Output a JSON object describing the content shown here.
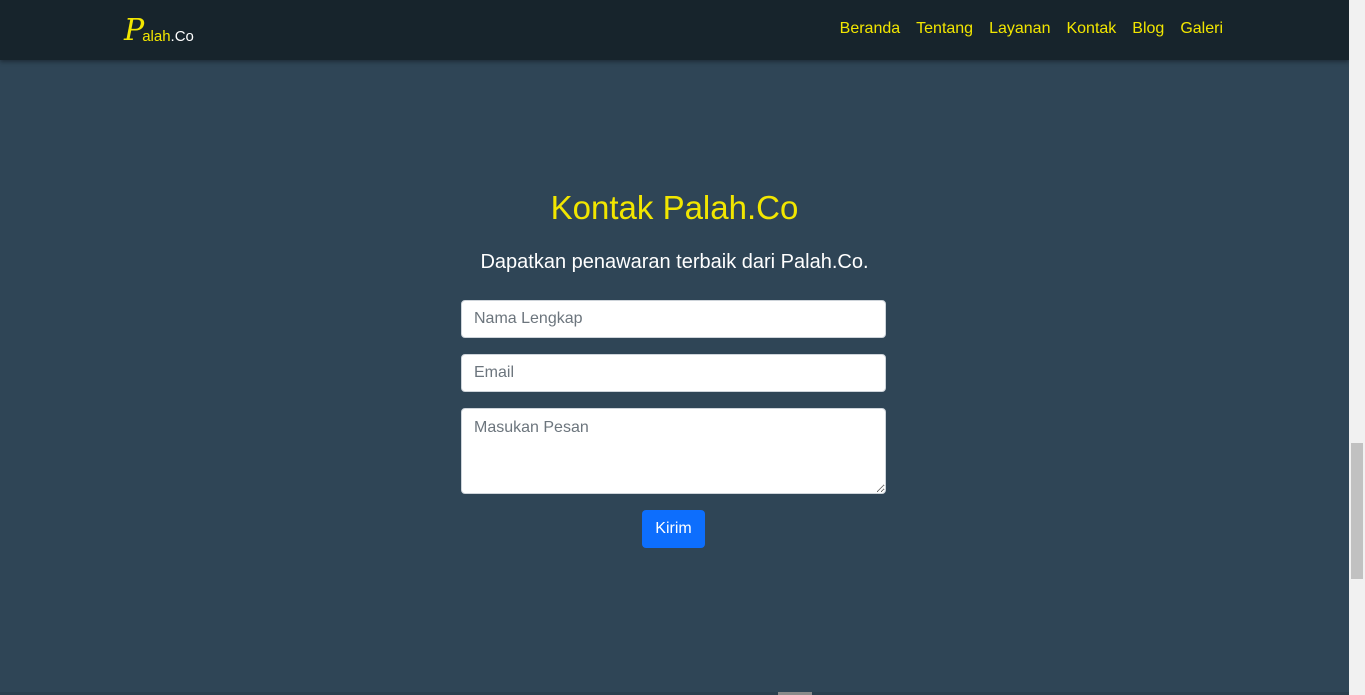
{
  "navbar": {
    "logo": {
      "initial": "P",
      "rest_a": "alah",
      "rest_b": ".Co"
    },
    "links": [
      "Beranda",
      "Tentang",
      "Layanan",
      "Kontak",
      "Blog",
      "Galeri"
    ]
  },
  "contact": {
    "title": "Kontak Palah.Co",
    "subtitle": "Dapatkan penawaran terbaik dari Palah.Co.",
    "name_placeholder": "Nama Lengkap",
    "email_placeholder": "Email",
    "message_placeholder": "Masukan Pesan",
    "submit_label": "Kirim"
  },
  "colors": {
    "background": "#2f4556",
    "navbar": "#17242c",
    "accent": "#f2e600",
    "button": "#0d6efd"
  }
}
